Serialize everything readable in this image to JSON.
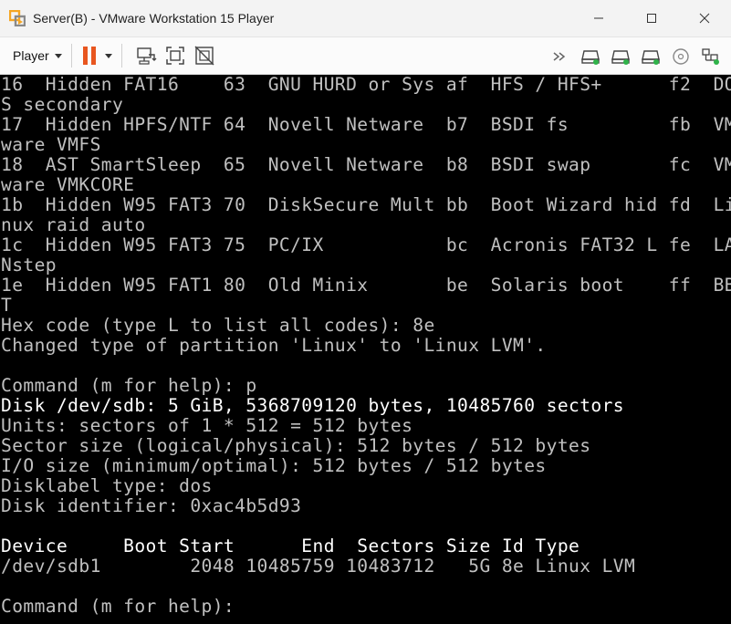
{
  "window": {
    "title": "Server(B) - VMware Workstation 15 Player"
  },
  "toolbar": {
    "player_label": "Player"
  },
  "icons": {
    "app": "vmware-player-icon",
    "minimize": "minimize-icon",
    "maximize": "maximize-icon",
    "close": "close-icon",
    "pause": "pause-icon",
    "send_cad": "ctrl-alt-del-icon",
    "fit_guest": "fit-guest-icon",
    "unity": "unity-icon",
    "more": "more-devices-icon",
    "hdd": "hard-disk-icon",
    "cd": "cd-rom-icon",
    "network": "network-adapter-icon"
  },
  "colors": {
    "pause_accent": "#e8561f",
    "device_led": "#2fb34a",
    "terminal_bg": "#000000",
    "terminal_text": "#c0c0c0"
  },
  "terminal": {
    "lines": [
      {
        "text": "16  Hidden FAT16    63  GNU HURD or Sys af  HFS / HFS+      f2  DO",
        "bright": false
      },
      {
        "text": "S secondary",
        "bright": false
      },
      {
        "text": "17  Hidden HPFS/NTF 64  Novell Netware  b7  BSDI fs         fb  VM",
        "bright": false
      },
      {
        "text": "ware VMFS",
        "bright": false
      },
      {
        "text": "18  AST SmartSleep  65  Novell Netware  b8  BSDI swap       fc  VM",
        "bright": false
      },
      {
        "text": "ware VMKCORE",
        "bright": false
      },
      {
        "text": "1b  Hidden W95 FAT3 70  DiskSecure Mult bb  Boot Wizard hid fd  Li",
        "bright": false
      },
      {
        "text": "nux raid auto",
        "bright": false
      },
      {
        "text": "1c  Hidden W95 FAT3 75  PC/IX           bc  Acronis FAT32 L fe  LA",
        "bright": false
      },
      {
        "text": "Nstep",
        "bright": false
      },
      {
        "text": "1e  Hidden W95 FAT1 80  Old Minix       be  Solaris boot    ff  BB",
        "bright": false
      },
      {
        "text": "T",
        "bright": false
      },
      {
        "text": "Hex code (type L to list all codes): 8e",
        "bright": false
      },
      {
        "text": "Changed type of partition 'Linux' to 'Linux LVM'.",
        "bright": false
      },
      {
        "text": "",
        "bright": false
      },
      {
        "text": "Command (m for help): p",
        "bright": false
      },
      {
        "text": "Disk /dev/sdb: 5 GiB, 5368709120 bytes, 10485760 sectors",
        "bright": true
      },
      {
        "text": "Units: sectors of 1 * 512 = 512 bytes",
        "bright": false
      },
      {
        "text": "Sector size (logical/physical): 512 bytes / 512 bytes",
        "bright": false
      },
      {
        "text": "I/O size (minimum/optimal): 512 bytes / 512 bytes",
        "bright": false
      },
      {
        "text": "Disklabel type: dos",
        "bright": false
      },
      {
        "text": "Disk identifier: 0xac4b5d93",
        "bright": false
      },
      {
        "text": "",
        "bright": false
      },
      {
        "text": "Device     Boot Start      End  Sectors Size Id Type",
        "bright": true
      },
      {
        "text": "/dev/sdb1        2048 10485759 10483712   5G 8e Linux LVM",
        "bright": false
      },
      {
        "text": "",
        "bright": false
      },
      {
        "text": "Command (m for help): ",
        "bright": false
      }
    ]
  }
}
